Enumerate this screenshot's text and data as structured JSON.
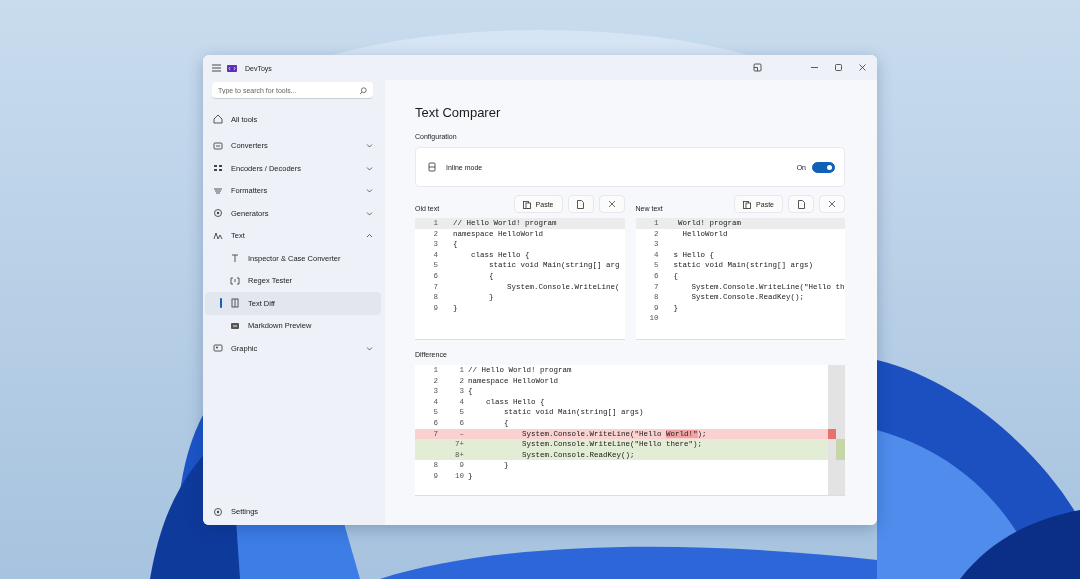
{
  "window": {
    "title": "DevToys"
  },
  "sidebar": {
    "search": {
      "placeholder": "Type to search for tools..."
    },
    "items": [
      {
        "label": "All tools",
        "kind": "link",
        "selected": false
      },
      {
        "label": "Converters",
        "kind": "group",
        "expanded": false,
        "selected": false
      },
      {
        "label": "Encoders / Decoders",
        "kind": "group",
        "expanded": false,
        "selected": false
      },
      {
        "label": "Formatters",
        "kind": "group",
        "expanded": false,
        "selected": false
      },
      {
        "label": "Generators",
        "kind": "group",
        "expanded": false,
        "selected": false
      },
      {
        "label": "Text",
        "kind": "group",
        "expanded": true,
        "selected": false,
        "children": [
          {
            "label": "Inspector & Case Converter",
            "selected": false
          },
          {
            "label": "Regex Tester",
            "selected": false
          },
          {
            "label": "Text Diff",
            "selected": true
          },
          {
            "label": "Markdown Preview",
            "selected": false
          }
        ]
      },
      {
        "label": "Graphic",
        "kind": "group",
        "expanded": false,
        "selected": false
      }
    ],
    "footer": {
      "label": "Settings"
    }
  },
  "page": {
    "title": "Text Comparer",
    "configuration": {
      "heading": "Configuration",
      "settings": [
        {
          "label": "Inline mode",
          "state_label": "On",
          "on": true
        }
      ]
    },
    "old_text": {
      "label": "Old text",
      "paste_label": "Paste",
      "lines": [
        {
          "number": "1",
          "text": "// Hello World! program"
        },
        {
          "number": "2",
          "text": "namespace HelloWorld"
        },
        {
          "number": "3",
          "text": "{"
        },
        {
          "number": "4",
          "text": "    class Hello {"
        },
        {
          "number": "5",
          "text": "        static void Main(string[] arg"
        },
        {
          "number": "6",
          "text": "        {"
        },
        {
          "number": "7",
          "text": "            System.Console.WriteLine("
        },
        {
          "number": "8",
          "text": "        }"
        },
        {
          "number": "9",
          "text": "}"
        }
      ]
    },
    "new_text": {
      "label": "New text",
      "paste_label": "Paste",
      "lines": [
        {
          "number": "1",
          "text": " World! program"
        },
        {
          "number": "2",
          "text": "  HelloWorld"
        },
        {
          "number": "3"
        },
        {
          "number": "4",
          "text": "s Hello {"
        },
        {
          "number": "5",
          "text": "static void Main(string[] args)"
        },
        {
          "number": "6",
          "text": "{"
        },
        {
          "number": "7",
          "text": "    System.Console.WriteLine(\"Hello th"
        },
        {
          "number": "8",
          "text": "    System.Console.ReadKey();"
        },
        {
          "number": "9",
          "text": "}"
        },
        {
          "number": "10"
        }
      ]
    },
    "difference": {
      "label": "Difference",
      "rows": [
        {
          "kind": "same",
          "old_number": "1",
          "new_number": "1",
          "parts": [
            {
              "text": "// Hello World! program",
              "changed": false
            }
          ]
        },
        {
          "kind": "same",
          "old_number": "2",
          "new_number": "2",
          "parts": [
            {
              "text": "namespace HelloWorld",
              "changed": false
            }
          ]
        },
        {
          "kind": "same",
          "old_number": "3",
          "new_number": "3",
          "parts": [
            {
              "text": "{",
              "changed": false
            }
          ]
        },
        {
          "kind": "same",
          "old_number": "4",
          "new_number": "4",
          "parts": [
            {
              "text": "    class Hello {",
              "changed": false
            }
          ]
        },
        {
          "kind": "same",
          "old_number": "5",
          "new_number": "5",
          "parts": [
            {
              "text": "        static void Main(string[] args)",
              "changed": false
            }
          ]
        },
        {
          "kind": "same",
          "old_number": "6",
          "new_number": "6",
          "parts": [
            {
              "text": "        {",
              "changed": false
            }
          ]
        },
        {
          "kind": "removed",
          "old_number": "7",
          "marker": "–",
          "parts": [
            {
              "text": "            System.Console.WriteLine(\"Hello ",
              "changed": false
            },
            {
              "text": "World!\"",
              "changed": true
            },
            {
              "text": ");",
              "changed": false
            }
          ]
        },
        {
          "kind": "added",
          "new_number": "7",
          "marker": "+",
          "parts": [
            {
              "text": "            System.Console.WriteLine(\"Hello there\");",
              "changed": false
            }
          ]
        },
        {
          "kind": "added",
          "new_number": "8",
          "marker": "+",
          "parts": [
            {
              "text": "            System.Console.ReadKey();",
              "changed": false
            }
          ]
        },
        {
          "kind": "same",
          "old_number": "8",
          "new_number": "9",
          "parts": [
            {
              "text": "        }",
              "changed": false
            }
          ]
        },
        {
          "kind": "same",
          "old_number": "9",
          "new_number": "10",
          "parts": [
            {
              "text": "}",
              "changed": false
            }
          ]
        }
      ]
    }
  }
}
